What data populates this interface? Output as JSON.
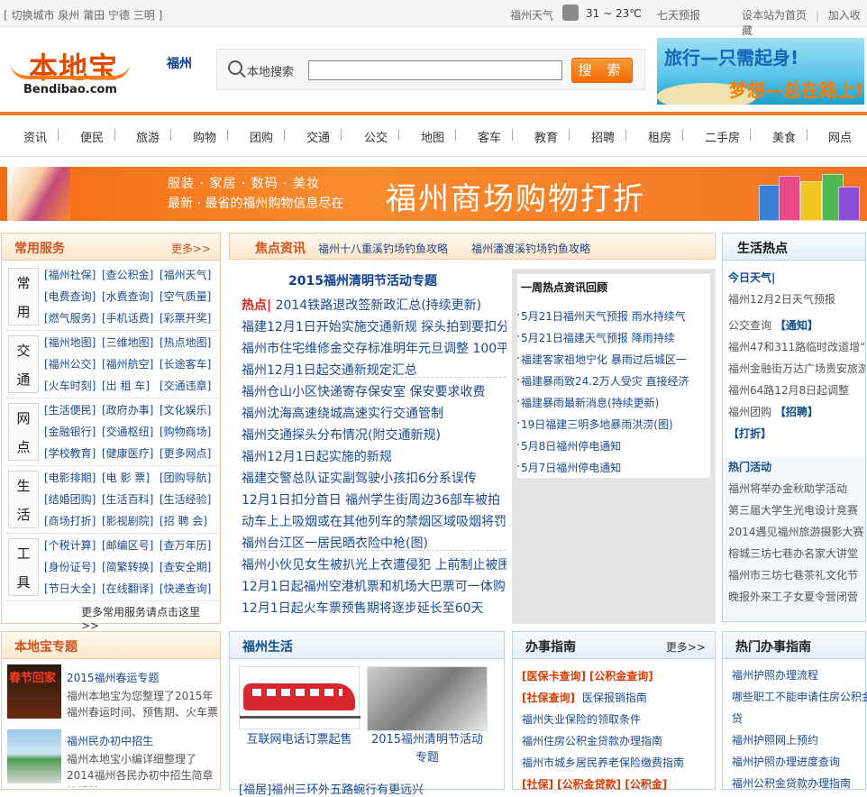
{
  "topbar": {
    "city_switch": "[ 切换城市  泉州 莆田 宁德 三明 ]",
    "weather_city": "福州天气",
    "temp": "31 ~ 23℃",
    "seven_day": "七天预报",
    "set_home": "设本站为首页",
    "sep": "|",
    "add_fav": "加入收藏"
  },
  "header": {
    "logo_cn": "本地宝",
    "logo_en": "Bendibao.com",
    "city": "福州",
    "search_label": "本地搜索",
    "search_value": "",
    "search_button": "搜 索",
    "ad_line1": "旅行—只需起身!",
    "ad_line2": "梦想—总在路上!"
  },
  "nav": [
    "资讯",
    "便民",
    "旅游",
    "购物",
    "团购",
    "交通",
    "公交",
    "地图",
    "客车",
    "教育",
    "招聘",
    "租房",
    "二手房",
    "美食",
    "网点"
  ],
  "banner": {
    "line1": "服装 · 家居 · 数码 · 美妆",
    "line2": "最新 · 最省的福州购物信息尽在",
    "big": "福州商场购物打折"
  },
  "services": {
    "title": "常用服务",
    "more": "更多>>",
    "groups": [
      {
        "tag1": "常",
        "tag2": "用",
        "links": [
          "[福州社保]",
          "[查公积金]",
          "[福州天气]",
          "[电费查询]",
          "[水费查询]",
          "[空气质量]",
          "[燃气服务]",
          "[手机话费]",
          "[彩票开奖]"
        ]
      },
      {
        "tag1": "交",
        "tag2": "通",
        "links": [
          "[福州地图]",
          "[三维地图]",
          "[热点地图]",
          "[福州公交]",
          "[福州航空]",
          "[长途客车]",
          "[火车时刻]",
          "[出 租 车]",
          "[交通违章]"
        ]
      },
      {
        "tag1": "网",
        "tag2": "点",
        "links": [
          "[生活便民]",
          "[政府办事]",
          "[文化娱乐]",
          "[金融银行]",
          "[交通枢纽]",
          "[购物商场]",
          "[学校教育]",
          "[健康医疗]",
          "[更多网点]"
        ]
      },
      {
        "tag1": "生",
        "tag2": "活",
        "links": [
          "[电影排期]",
          "[电 影 票]",
          "[团购导航]",
          "[结婚团购]",
          "[生活百科]",
          "[生活经验]",
          "[商场打折]",
          "[影视剧院]",
          "[招 聘 会]"
        ]
      },
      {
        "tag1": "工",
        "tag2": "具",
        "links": [
          "[个税计算]",
          "[邮编区号]",
          "[查万年历]",
          "[身份证号]",
          "[简繁转换]",
          "[查安全期]",
          "[节日大全]",
          "[在线翻译]",
          "[快递查询]"
        ]
      }
    ],
    "footer": "更多常用服务请点击这里 >>"
  },
  "focus": {
    "title": "焦点资讯",
    "link1": "福州十八重溪钓场钓鱼攻略",
    "link2": "福州潘渡溪钓场钓鱼攻略",
    "headline": "2015福州清明节活动专题",
    "hot_label": "热点|",
    "hot_text": "2014铁路退改签新政汇总(持续更新)",
    "lines": [
      "福建12月1日开始实施交通新规  探头拍到要扣分",
      "福州市住宅维修金交存标准明年元旦调整  100平",
      "福州12月1日起交通新规定汇总",
      "福州仓山小区快递寄存保安室  保安要求收费",
      "福州沈海高速绕城高速实行交通管制",
      "福州交通探头分布情况(附交通新规)",
      "福州12月1日起实施的新规",
      "福建交警总队证实副驾驶小孩扣6分系误传",
      "12月1日扣分首日  福州学生街周边36部车被拍",
      "动车上上吸烟或在其他列车的禁烟区域吸烟将罚",
      "福州台江区一居民晒衣险中枪(图)",
      "福州小伙见女生被扒光上衣遭侵犯  上前制止被围",
      "12月1日起福州空港机票和机场大巴票可一体购买",
      "12月1日起火车票预售期将逐步延长至60天"
    ]
  },
  "weekly": {
    "title": "一周热点资讯回顾",
    "items": [
      "5月21日福州天气预报 雨水持续气",
      "5月21日福建天气预报 降雨持续",
      "福建客家祖地宁化 暴雨过后城区一",
      "福建暴雨致24.2万人受灾 直接经济",
      "福建暴雨最新消息(持续更新)",
      "19日福建三明多地暴雨洪涝(图)",
      "5月8日福州停电通知",
      "5月7日福州停电通知"
    ]
  },
  "life": {
    "title": "生活热点",
    "today_weather": "今日天气|",
    "weather_item": "福州12月2日天气预报",
    "bus_label": "公交查询",
    "notice_tag": "【通知】",
    "bus1": "福州47和311路临时改道增“",
    "bus2": "福州金融街万达广场贵安旅游",
    "bus3": "福州64路12月8日起调整",
    "groupbuy_label": "福州团购",
    "recruit_tag": "【招聘】",
    "discount_tag": "【打折】",
    "act_title": "热门活动",
    "acts": [
      "福州将举办金秋助学活动",
      "第三届大学生光电设计竞赛",
      "2014遇见福州旅游摄影大赛",
      "榕城三坊七巷办名家大讲堂",
      "福州市三坊七巷茶礼文化节",
      "晚报外来工子女夏令营闭营"
    ]
  },
  "topics": {
    "title": "本地宝专题",
    "items": [
      {
        "title": "2015福州春运专题",
        "desc": "福州本地宝为您整理了2015年福州春运时间、预售期、火车票购",
        "img": "春节回家"
      },
      {
        "title": "福州民办初中招生",
        "desc": "福州本地宝小编详细整理了2014福州各民办初中招生简章的相关"
      }
    ]
  },
  "fzlife": {
    "title": "福州生活",
    "cap1": "互联网电话订票起售",
    "cap2": "2015福州清明节活动专题",
    "bottom": "[福居]福州三环外五路蜿行有更远兴"
  },
  "guide": {
    "title": "办事指南",
    "more": "更多>>",
    "tag1": "[医保卡查询]",
    "tag2": "[公积金查询]",
    "tag3": "[社保查询]",
    "row2_text": "医保报销指南",
    "items": [
      "福州失业保险的领取条件",
      "福州住房公积金贷款办理指南",
      "福州市城乡居民养老保险缴费指南"
    ],
    "bottom": "[社保] [公积金贷款] [公积金]"
  },
  "hotguide": {
    "title": "热门办事指南",
    "items": [
      "福州护照办理流程",
      "哪些职工不能申请住房公积金贷",
      "福州护照网上预约",
      "福州护照办理进度查询",
      "福州公积金贷款办理指南"
    ]
  }
}
